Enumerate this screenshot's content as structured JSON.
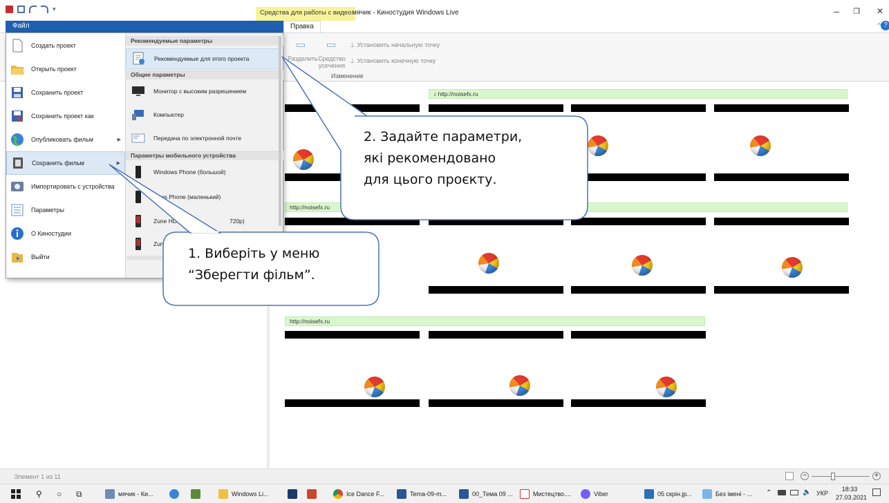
{
  "window": {
    "context_tab": "Средства для работы с видео",
    "title": "мячик - Киностудия Windows Live",
    "minimize": "–",
    "maximize": "❐",
    "close": "✕"
  },
  "ribbon": {
    "file_tab": "Файл",
    "edit_tab": "Правка",
    "collapse_glyph": "^",
    "help_glyph": "?",
    "split": "Разделить",
    "trim_line1": "Средство",
    "trim_line2": "усечения",
    "set_start": "Установить начальную точку",
    "set_end": "Установить конечную точку",
    "group": "Изменение"
  },
  "file_menu": {
    "items": [
      {
        "label": "Создать проект"
      },
      {
        "label": "Открыть проект"
      },
      {
        "label": "Сохранить проект"
      },
      {
        "label": "Сохранить проект как"
      },
      {
        "label": "Опубликовать фильм"
      },
      {
        "label": "Сохранить фильм"
      },
      {
        "label": "Импортировать с устройства"
      },
      {
        "label": "Параметры"
      },
      {
        "label": "О Киностудии"
      },
      {
        "label": "Выйти"
      }
    ],
    "section_recommended": "Рекомендуемые параметры",
    "recommended_option": "Рекомендуемые для этого проекта",
    "section_general": "Общие параметры",
    "hd_monitor": "Монитор с высоким разрешением",
    "computer": "Компьютер",
    "email": "Передача по электронной почте",
    "section_mobile": "Параметры мобильного устройства",
    "wp_large": "Windows Phone (большой)",
    "wp_small": "dows Phone (маленький)",
    "zune_hd": "Zune HD",
    "zune_hd_res": "720p)",
    "zune_other": "Zun"
  },
  "storyboard": {
    "audio_label_1": "♪ http://noisefx.ru",
    "audio_label_2": "http://noisefx.ru",
    "audio_label_3": "http://noisefx.ru"
  },
  "callouts": {
    "step2": [
      "2. Задайте параметри,",
      "які рекомендовано",
      "для цього проєкту."
    ],
    "step1": [
      "1. Виберіть у меню",
      "“Зберегти фільм”."
    ]
  },
  "status": {
    "element_count": "Элемент 1 из 11"
  },
  "taskbar": {
    "items": [
      "мячик - Ки...",
      "Windows Li...",
      "Ice Dance F...",
      "Tema-09-m...",
      "00_Тема 09 ...",
      "Мистецтво....",
      "Viber",
      "05 скрін.jp...",
      "Без імені - ..."
    ],
    "lang": "УКР",
    "time": "18:33",
    "date": "27.03.2021"
  }
}
